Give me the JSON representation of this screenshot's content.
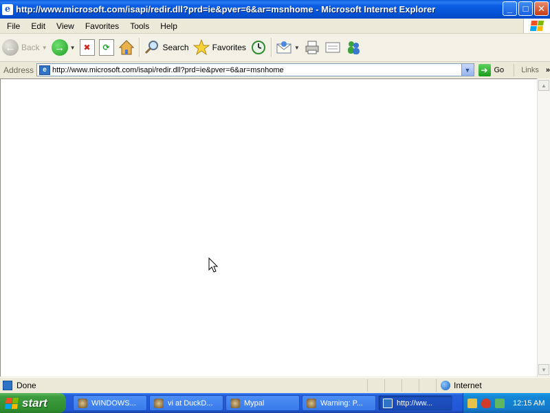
{
  "window": {
    "title": "http://www.microsoft.com/isapi/redir.dll?prd=ie&pver=6&ar=msnhome - Microsoft Internet Explorer",
    "controls": {
      "minimize": "_",
      "maximize": "□",
      "close": "✕"
    }
  },
  "menu": [
    "File",
    "Edit",
    "View",
    "Favorites",
    "Tools",
    "Help"
  ],
  "toolbar": {
    "back_label": "Back",
    "search_label": "Search",
    "favorites_label": "Favorites"
  },
  "address": {
    "label": "Address",
    "url": "http://www.microsoft.com/isapi/redir.dll?prd=ie&pver=6&ar=msnhome",
    "go_label": "Go",
    "links_label": "Links",
    "more": "»"
  },
  "status": {
    "text": "Done",
    "zone": "Internet"
  },
  "taskbar": {
    "start_label": "start",
    "tasks": [
      {
        "label": "WINDOWS...",
        "active": false
      },
      {
        "label": "vi at DuckD...",
        "active": false
      },
      {
        "label": "Mypal",
        "active": false
      },
      {
        "label": "Warning: P...",
        "active": false
      },
      {
        "label": "http://ww...",
        "active": true
      }
    ],
    "clock": "12:15 AM"
  },
  "colors": {
    "titlebar": "#0552D6",
    "taskbar": "#245EDB",
    "start": "#3C9B3C",
    "tray": "#137BCB"
  }
}
